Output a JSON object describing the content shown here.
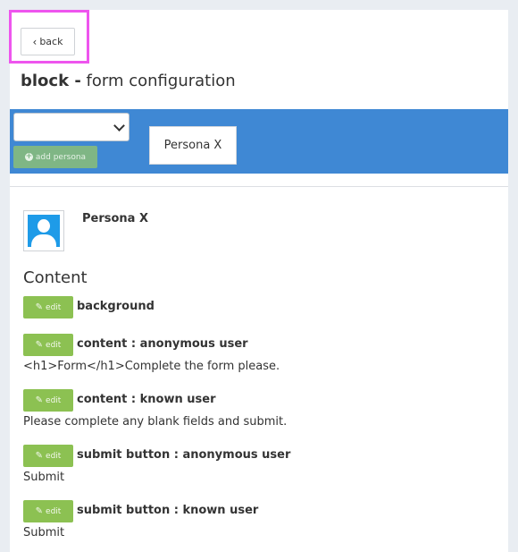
{
  "back_button": {
    "label": "back",
    "icon": "chevron-left-icon"
  },
  "title": {
    "bold": "block -",
    "rest": "form configuration"
  },
  "toolbar": {
    "persona_select_value": "",
    "add_persona_label": "add persona",
    "tabs": [
      {
        "label": "Persona X"
      }
    ],
    "accent": "#3f88d4"
  },
  "persona": {
    "name": "Persona X"
  },
  "content": {
    "heading": "Content",
    "edit_label": "edit",
    "items": [
      {
        "label": "background",
        "value": ""
      },
      {
        "label": "content : anonymous user",
        "value": "<h1>Form</h1>Complete the form please."
      },
      {
        "label": "content : known user",
        "value": "Please complete any blank fields and submit."
      },
      {
        "label": "submit button : anonymous user",
        "value": "Submit"
      },
      {
        "label": "submit button : known user",
        "value": "Submit"
      }
    ]
  }
}
